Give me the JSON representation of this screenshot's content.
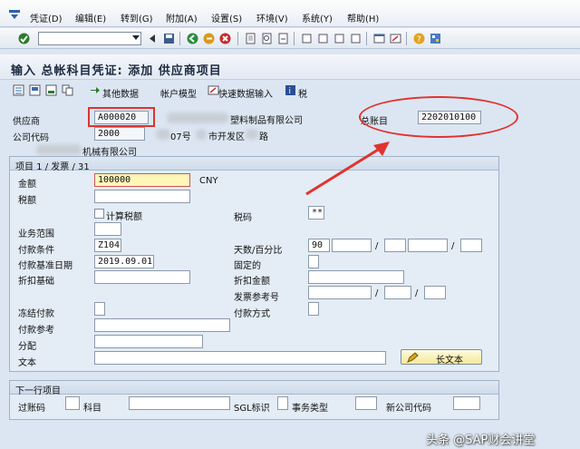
{
  "menu": [
    "凭证(D)",
    "编辑(E)",
    "转到(G)",
    "附加(A)",
    "设置(S)",
    "环境(V)",
    "系统(Y)",
    "帮助(H)"
  ],
  "command_field": {
    "value": ""
  },
  "title": "输入 总帐科目凭证: 添加 供应商项目",
  "app_toolbar": {
    "other_data": "其他数据",
    "account_model": "帐户模型",
    "fast_entry": "快速数据输入",
    "tax": "税"
  },
  "header": {
    "vendor_label": "供应商",
    "vendor_value": "A000020",
    "vendor_name_partial": "塑料制品有限公司",
    "company_code_label": "公司代码",
    "company_code_value": "2000",
    "address_partial_1": "07号",
    "address_partial_2": "市开发区",
    "address_partial_3": "路",
    "company_name_partial": "机械有限公司",
    "gl_account_label": "总账目",
    "gl_account_value": "2202010100"
  },
  "item": {
    "group_title": "项目 1 / 发票 / 31",
    "amount_label": "金额",
    "amount_value": "100000",
    "currency": "CNY",
    "tax_amount_label": "税额",
    "calc_tax_label": "计算税额",
    "tax_code_label": "税码",
    "tax_code_value": "**",
    "business_area_label": "业务范围",
    "payment_terms_label": "付款条件",
    "payment_terms_value": "Z104",
    "days_pct_label": "天数/百分比",
    "days_value": "90",
    "baseline_date_label": "付款基准日期",
    "baseline_date_value": "2019.09.01",
    "fixed_label": "固定的",
    "discount_base_label": "折扣基础",
    "discount_amount_label": "折扣金额",
    "invoice_ref_label": "发票参考号",
    "payment_block_label": "冻结付款",
    "payment_method_label": "付款方式",
    "payment_ref_label": "付款参考",
    "assignment_label": "分配",
    "text_label": "文本",
    "long_text_button": "长文本",
    "slash": "/"
  },
  "next_item": {
    "group_title": "下一行项目",
    "posting_key_label": "过账码",
    "account_label": "科目",
    "sgl_label": "SGL标识",
    "trans_type_label": "事务类型",
    "new_company_label": "新公司代码"
  },
  "watermark": "头条 @SAP财会讲堂",
  "colors": {
    "annotation": "#e0332f",
    "active_field": "#fff6b8",
    "title": "#1c2a40"
  }
}
